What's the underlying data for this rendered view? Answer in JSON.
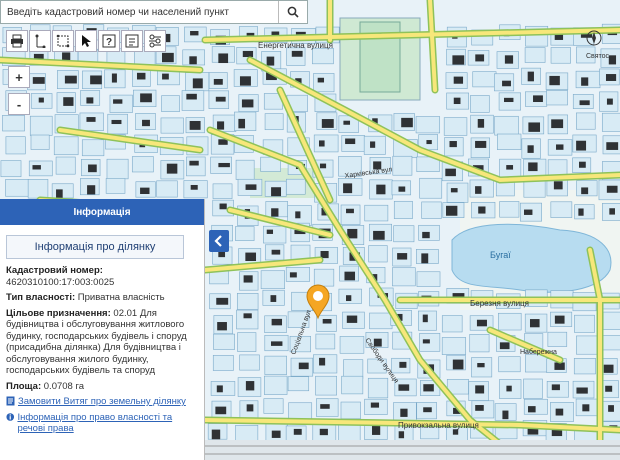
{
  "search": {
    "placeholder": "Введіть кадастровий номер чи населений пункт"
  },
  "toolbar": {
    "tools": [
      "print-icon",
      "ruler-icon",
      "area-measure-icon",
      "pointer-icon",
      "help-icon",
      "info-icon",
      "layers-icon"
    ]
  },
  "zoom": {
    "in_label": "+",
    "out_label": "-"
  },
  "map": {
    "street_labels": {
      "energetychna": "Енергетична вулиця",
      "bugai": "Бугаї",
      "pryvokzalna": "Привокзальна вулиця",
      "berezneva": "Березня вулиця",
      "naberezhna": "Набережна",
      "kharkivska": "Харківська вул",
      "svyatoslav": "Святос",
      "svobody": "Свободи вулиця",
      "sotsialna": "Соціальна вул"
    },
    "colors": {
      "road": "#f7e77a",
      "road_border": "#8fc25a",
      "building": "#333333",
      "parcel_fill": "#d5e8f3",
      "parcel_line": "#7aa9c9",
      "water": "#b7dcf0",
      "green": "#d3ead6",
      "marker": "#f5a623"
    }
  },
  "panel": {
    "header": "Інформація",
    "subheader": "Інформація про ділянку",
    "cadastral_label": "Кадастровий номер:",
    "cadastral_value": "4620310100:17:003:0025",
    "ownership_label": "Тип власності:",
    "ownership_value": "Приватна власність",
    "purpose_label": "Цільове призначення:",
    "purpose_value": "02.01 Для будівництва і обслуговування житлового будинку, господарських будівель і споруд (присадибна ділянка) Для будівництва і обслуговування жилого будинку, господарських будівель та споруд",
    "area_label": "Площа:",
    "area_value": "0.0708 га",
    "link_extract": "Замовити Витяг про земельну ділянку",
    "link_rights": "Інформація про право власності та речові права"
  },
  "colors": {
    "accent": "#2d63b7"
  }
}
